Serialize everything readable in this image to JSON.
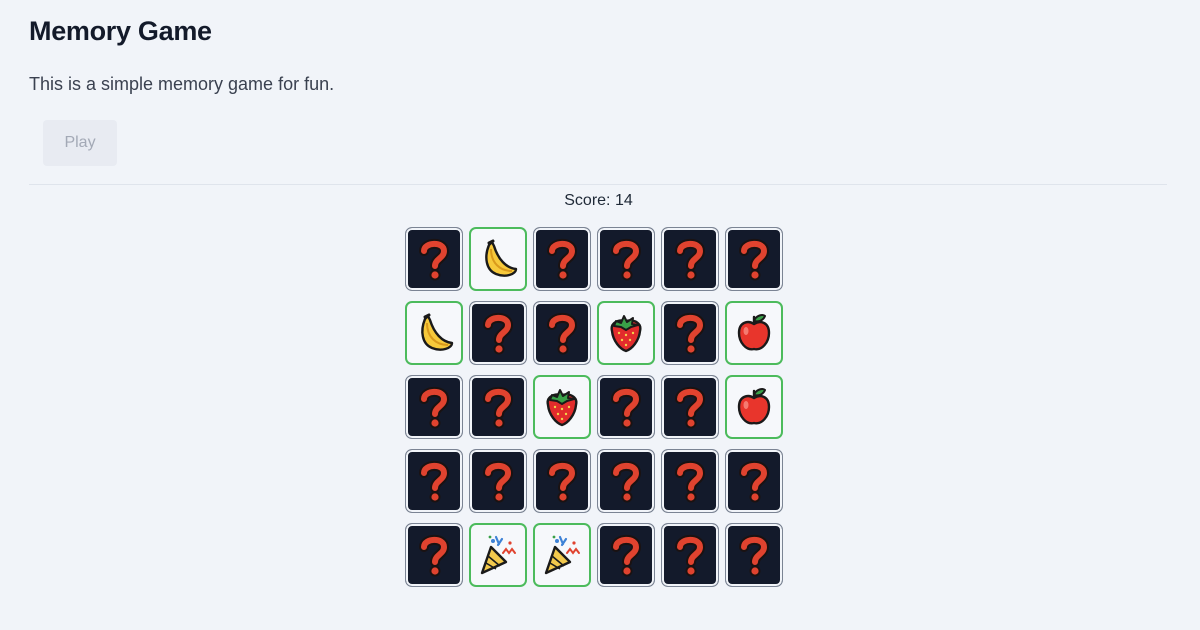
{
  "header": {
    "title": "Memory Game",
    "description": "This is a simple memory game for fun."
  },
  "controls": {
    "play_label": "Play"
  },
  "score_text": "Score: 14",
  "board": {
    "rows": 5,
    "cols": 6,
    "cards": [
      {
        "face": "hidden"
      },
      {
        "face": "banana"
      },
      {
        "face": "hidden"
      },
      {
        "face": "hidden"
      },
      {
        "face": "hidden"
      },
      {
        "face": "hidden"
      },
      {
        "face": "banana"
      },
      {
        "face": "hidden"
      },
      {
        "face": "hidden"
      },
      {
        "face": "strawberry"
      },
      {
        "face": "hidden"
      },
      {
        "face": "apple"
      },
      {
        "face": "hidden"
      },
      {
        "face": "hidden"
      },
      {
        "face": "strawberry"
      },
      {
        "face": "hidden"
      },
      {
        "face": "hidden"
      },
      {
        "face": "apple"
      },
      {
        "face": "hidden"
      },
      {
        "face": "hidden"
      },
      {
        "face": "hidden"
      },
      {
        "face": "hidden"
      },
      {
        "face": "hidden"
      },
      {
        "face": "hidden"
      },
      {
        "face": "hidden"
      },
      {
        "face": "party-popper"
      },
      {
        "face": "party-popper"
      },
      {
        "face": "hidden"
      },
      {
        "face": "hidden"
      },
      {
        "face": "hidden"
      }
    ]
  },
  "colors": {
    "card_back": "#131a2b",
    "question_mark": "#e0432f",
    "matched_border": "#4cbb5c",
    "page_background": "#f1f4f9"
  }
}
